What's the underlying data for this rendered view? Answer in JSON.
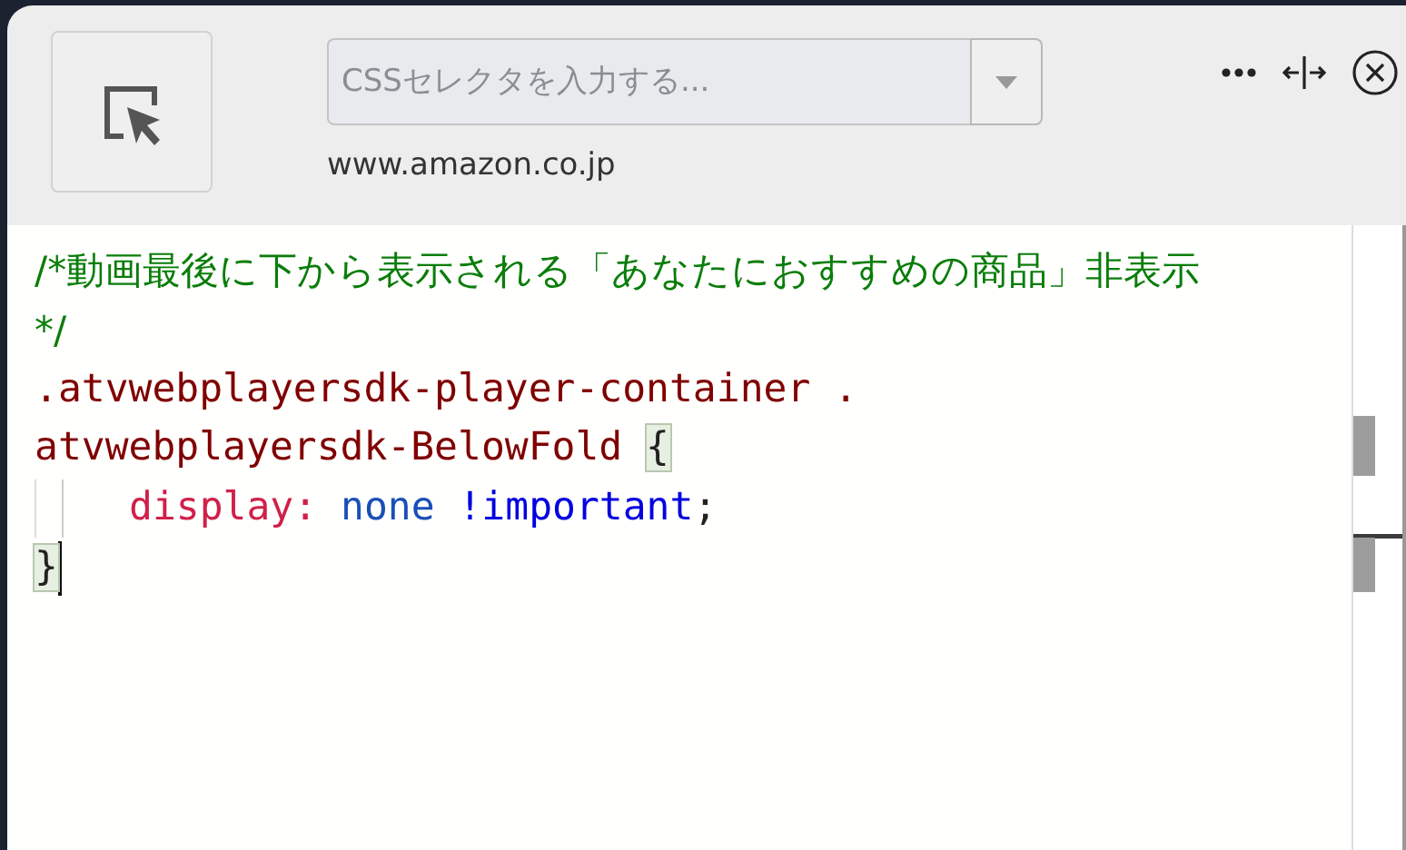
{
  "toolbar": {
    "selector_field": {
      "placeholder": "CSSセレクタを入力する..."
    },
    "site": "www.amazon.co.jp"
  },
  "editor": {
    "lines": [
      {
        "tokens": [
          {
            "kind": "comment",
            "text": "/*動画最後に下から表示される「あなたにおすすめの商品」非表示"
          }
        ]
      },
      {
        "tokens": [
          {
            "kind": "comment",
            "text": "*/"
          }
        ]
      },
      {
        "tokens": [
          {
            "kind": "selector",
            "text": ".atvwebplayersdk-player-container ."
          }
        ]
      },
      {
        "tokens": [
          {
            "kind": "selector",
            "text": "atvwebplayersdk-BelowFold "
          },
          {
            "kind": "bracket",
            "text": "{"
          }
        ]
      },
      {
        "tokens": [
          {
            "kind": "indent"
          },
          {
            "kind": "property",
            "text": "display:"
          },
          {
            "kind": "value",
            "text": " none "
          },
          {
            "kind": "important",
            "text": "!important"
          },
          {
            "kind": "plain",
            "text": ";"
          }
        ]
      },
      {
        "tokens": [
          {
            "kind": "bracket",
            "text": "}"
          },
          {
            "kind": "cursor"
          }
        ]
      }
    ]
  }
}
